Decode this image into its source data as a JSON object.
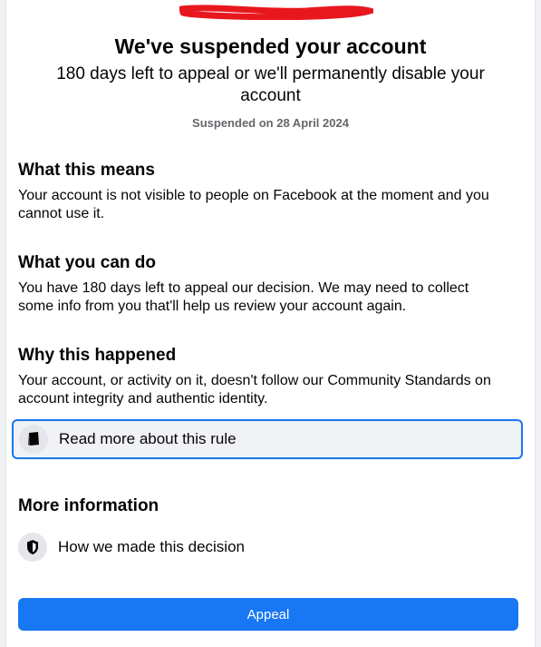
{
  "header": {
    "title": "We've suspended your account",
    "subtitle": "180 days left to appeal or we'll permanently disable your account",
    "suspended_date": "Suspended on 28 April 2024"
  },
  "sections": {
    "what_this_means": {
      "heading": "What this means",
      "body": "Your account is not visible to people on Facebook at the moment and you cannot use it."
    },
    "what_you_can_do": {
      "heading": "What you can do",
      "body": "You have 180 days left to appeal our decision. We may need to collect some info from you that'll help us review your account again."
    },
    "why_this_happened": {
      "heading": "Why this happened",
      "body": "Your account, or activity on it, doesn't follow our Community Standards on account integrity and authentic identity.",
      "rule_link": {
        "label": "Read more about this rule",
        "icon": "book-icon"
      }
    },
    "more_information": {
      "heading": "More information",
      "decision_link": {
        "label": "How we made this decision",
        "icon": "shield-icon"
      }
    }
  },
  "actions": {
    "appeal_label": "Appeal"
  },
  "colors": {
    "accent": "#1877f2",
    "redaction": "#e8171e",
    "muted_text": "#65676b"
  }
}
